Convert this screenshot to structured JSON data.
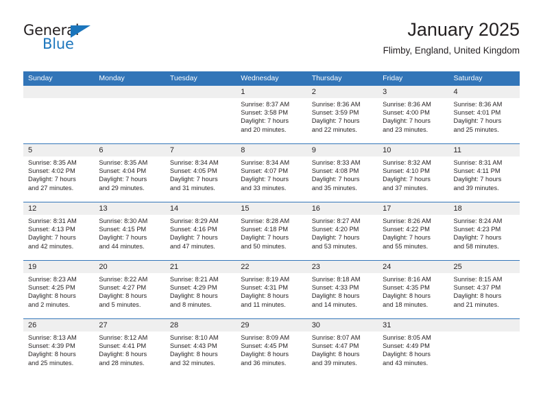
{
  "logo": {
    "word_general": "General",
    "word_blue": "Blue",
    "triangle_color": "#1b75bc"
  },
  "header": {
    "title": "January 2025",
    "subtitle": "Flimby, England, United Kingdom",
    "accent_color": "#3275b8",
    "daynum_band_color": "#efefef"
  },
  "weekday_headers": [
    "Sunday",
    "Monday",
    "Tuesday",
    "Wednesday",
    "Thursday",
    "Friday",
    "Saturday"
  ],
  "weeks": [
    [
      {
        "day": "",
        "sunrise": "",
        "sunset": "",
        "daylight1": "",
        "daylight2": ""
      },
      {
        "day": "",
        "sunrise": "",
        "sunset": "",
        "daylight1": "",
        "daylight2": ""
      },
      {
        "day": "",
        "sunrise": "",
        "sunset": "",
        "daylight1": "",
        "daylight2": ""
      },
      {
        "day": "1",
        "sunrise": "Sunrise: 8:37 AM",
        "sunset": "Sunset: 3:58 PM",
        "daylight1": "Daylight: 7 hours",
        "daylight2": "and 20 minutes."
      },
      {
        "day": "2",
        "sunrise": "Sunrise: 8:36 AM",
        "sunset": "Sunset: 3:59 PM",
        "daylight1": "Daylight: 7 hours",
        "daylight2": "and 22 minutes."
      },
      {
        "day": "3",
        "sunrise": "Sunrise: 8:36 AM",
        "sunset": "Sunset: 4:00 PM",
        "daylight1": "Daylight: 7 hours",
        "daylight2": "and 23 minutes."
      },
      {
        "day": "4",
        "sunrise": "Sunrise: 8:36 AM",
        "sunset": "Sunset: 4:01 PM",
        "daylight1": "Daylight: 7 hours",
        "daylight2": "and 25 minutes."
      }
    ],
    [
      {
        "day": "5",
        "sunrise": "Sunrise: 8:35 AM",
        "sunset": "Sunset: 4:02 PM",
        "daylight1": "Daylight: 7 hours",
        "daylight2": "and 27 minutes."
      },
      {
        "day": "6",
        "sunrise": "Sunrise: 8:35 AM",
        "sunset": "Sunset: 4:04 PM",
        "daylight1": "Daylight: 7 hours",
        "daylight2": "and 29 minutes."
      },
      {
        "day": "7",
        "sunrise": "Sunrise: 8:34 AM",
        "sunset": "Sunset: 4:05 PM",
        "daylight1": "Daylight: 7 hours",
        "daylight2": "and 31 minutes."
      },
      {
        "day": "8",
        "sunrise": "Sunrise: 8:34 AM",
        "sunset": "Sunset: 4:07 PM",
        "daylight1": "Daylight: 7 hours",
        "daylight2": "and 33 minutes."
      },
      {
        "day": "9",
        "sunrise": "Sunrise: 8:33 AM",
        "sunset": "Sunset: 4:08 PM",
        "daylight1": "Daylight: 7 hours",
        "daylight2": "and 35 minutes."
      },
      {
        "day": "10",
        "sunrise": "Sunrise: 8:32 AM",
        "sunset": "Sunset: 4:10 PM",
        "daylight1": "Daylight: 7 hours",
        "daylight2": "and 37 minutes."
      },
      {
        "day": "11",
        "sunrise": "Sunrise: 8:31 AM",
        "sunset": "Sunset: 4:11 PM",
        "daylight1": "Daylight: 7 hours",
        "daylight2": "and 39 minutes."
      }
    ],
    [
      {
        "day": "12",
        "sunrise": "Sunrise: 8:31 AM",
        "sunset": "Sunset: 4:13 PM",
        "daylight1": "Daylight: 7 hours",
        "daylight2": "and 42 minutes."
      },
      {
        "day": "13",
        "sunrise": "Sunrise: 8:30 AM",
        "sunset": "Sunset: 4:15 PM",
        "daylight1": "Daylight: 7 hours",
        "daylight2": "and 44 minutes."
      },
      {
        "day": "14",
        "sunrise": "Sunrise: 8:29 AM",
        "sunset": "Sunset: 4:16 PM",
        "daylight1": "Daylight: 7 hours",
        "daylight2": "and 47 minutes."
      },
      {
        "day": "15",
        "sunrise": "Sunrise: 8:28 AM",
        "sunset": "Sunset: 4:18 PM",
        "daylight1": "Daylight: 7 hours",
        "daylight2": "and 50 minutes."
      },
      {
        "day": "16",
        "sunrise": "Sunrise: 8:27 AM",
        "sunset": "Sunset: 4:20 PM",
        "daylight1": "Daylight: 7 hours",
        "daylight2": "and 53 minutes."
      },
      {
        "day": "17",
        "sunrise": "Sunrise: 8:26 AM",
        "sunset": "Sunset: 4:22 PM",
        "daylight1": "Daylight: 7 hours",
        "daylight2": "and 55 minutes."
      },
      {
        "day": "18",
        "sunrise": "Sunrise: 8:24 AM",
        "sunset": "Sunset: 4:23 PM",
        "daylight1": "Daylight: 7 hours",
        "daylight2": "and 58 minutes."
      }
    ],
    [
      {
        "day": "19",
        "sunrise": "Sunrise: 8:23 AM",
        "sunset": "Sunset: 4:25 PM",
        "daylight1": "Daylight: 8 hours",
        "daylight2": "and 2 minutes."
      },
      {
        "day": "20",
        "sunrise": "Sunrise: 8:22 AM",
        "sunset": "Sunset: 4:27 PM",
        "daylight1": "Daylight: 8 hours",
        "daylight2": "and 5 minutes."
      },
      {
        "day": "21",
        "sunrise": "Sunrise: 8:21 AM",
        "sunset": "Sunset: 4:29 PM",
        "daylight1": "Daylight: 8 hours",
        "daylight2": "and 8 minutes."
      },
      {
        "day": "22",
        "sunrise": "Sunrise: 8:19 AM",
        "sunset": "Sunset: 4:31 PM",
        "daylight1": "Daylight: 8 hours",
        "daylight2": "and 11 minutes."
      },
      {
        "day": "23",
        "sunrise": "Sunrise: 8:18 AM",
        "sunset": "Sunset: 4:33 PM",
        "daylight1": "Daylight: 8 hours",
        "daylight2": "and 14 minutes."
      },
      {
        "day": "24",
        "sunrise": "Sunrise: 8:16 AM",
        "sunset": "Sunset: 4:35 PM",
        "daylight1": "Daylight: 8 hours",
        "daylight2": "and 18 minutes."
      },
      {
        "day": "25",
        "sunrise": "Sunrise: 8:15 AM",
        "sunset": "Sunset: 4:37 PM",
        "daylight1": "Daylight: 8 hours",
        "daylight2": "and 21 minutes."
      }
    ],
    [
      {
        "day": "26",
        "sunrise": "Sunrise: 8:13 AM",
        "sunset": "Sunset: 4:39 PM",
        "daylight1": "Daylight: 8 hours",
        "daylight2": "and 25 minutes."
      },
      {
        "day": "27",
        "sunrise": "Sunrise: 8:12 AM",
        "sunset": "Sunset: 4:41 PM",
        "daylight1": "Daylight: 8 hours",
        "daylight2": "and 28 minutes."
      },
      {
        "day": "28",
        "sunrise": "Sunrise: 8:10 AM",
        "sunset": "Sunset: 4:43 PM",
        "daylight1": "Daylight: 8 hours",
        "daylight2": "and 32 minutes."
      },
      {
        "day": "29",
        "sunrise": "Sunrise: 8:09 AM",
        "sunset": "Sunset: 4:45 PM",
        "daylight1": "Daylight: 8 hours",
        "daylight2": "and 36 minutes."
      },
      {
        "day": "30",
        "sunrise": "Sunrise: 8:07 AM",
        "sunset": "Sunset: 4:47 PM",
        "daylight1": "Daylight: 8 hours",
        "daylight2": "and 39 minutes."
      },
      {
        "day": "31",
        "sunrise": "Sunrise: 8:05 AM",
        "sunset": "Sunset: 4:49 PM",
        "daylight1": "Daylight: 8 hours",
        "daylight2": "and 43 minutes."
      },
      {
        "day": "",
        "sunrise": "",
        "sunset": "",
        "daylight1": "",
        "daylight2": ""
      }
    ]
  ]
}
